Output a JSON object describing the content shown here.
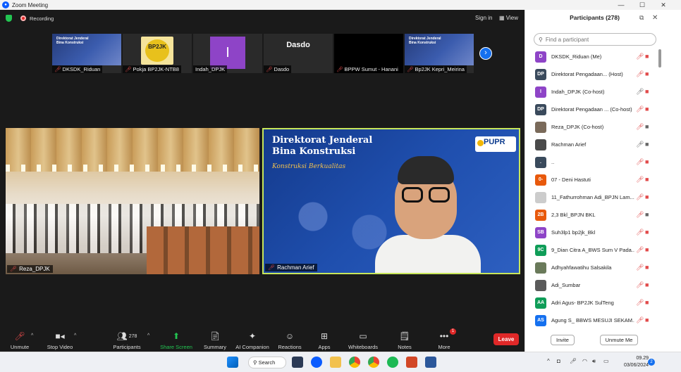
{
  "window": {
    "title": "Zoom Meeting",
    "min": "—",
    "max": "☐",
    "close": "✕"
  },
  "topbar": {
    "recording": "Recording",
    "signin": "Sign in",
    "view": "View"
  },
  "strip": [
    {
      "name": "DKSDK_Riduan",
      "muted": true
    },
    {
      "name": "Pokja BP2JK-NTB8",
      "muted": true,
      "logo_text": "BP2JK"
    },
    {
      "name": "Indah_DPJK",
      "muted": false,
      "initial": "I"
    },
    {
      "name": "Dasdo",
      "muted": true,
      "display": "Dasdo"
    },
    {
      "name": "BPPW Sumut - Hanani",
      "muted": true
    },
    {
      "name": "Bp2JK Kepri_Meirina",
      "muted": true
    }
  ],
  "main_tiles": {
    "left": {
      "name": "Reza_DPJK"
    },
    "right": {
      "name": "Rachman Arief",
      "slide_title_1": "Direktorat Jenderal",
      "slide_title_2": "Bina Konstruksi",
      "slide_subtitle": "Konstruksi Berkualitas",
      "logo": "PUPR"
    }
  },
  "toolbar": {
    "unmute": "Unmute",
    "stop_video": "Stop Video",
    "participants": "Participants",
    "participants_count": "278",
    "share_screen": "Share Screen",
    "summary": "Summary",
    "ai_companion": "AI Companion",
    "reactions": "Reactions",
    "apps": "Apps",
    "whiteboards": "Whiteboards",
    "notes": "Notes",
    "more": "More",
    "more_badge": "1",
    "leave": "Leave"
  },
  "panel": {
    "title": "Participants (278)",
    "search_placeholder": "Find a participant",
    "invite": "Invite",
    "unmute_me": "Unmute Me",
    "participants": [
      {
        "initials": "D",
        "name": "DKSDK_Riduan (Me)",
        "color": "#8e44c7",
        "mic": "muted",
        "cam": "off"
      },
      {
        "initials": "DP",
        "name": "Direktorat Pengadaan... (Host)",
        "color": "#3a4a5c",
        "mic": "muted",
        "cam": "off",
        "rec": true
      },
      {
        "initials": "I",
        "name": "Indah_DPJK (Co-host)",
        "color": "#8e44c7",
        "mic": "on",
        "cam": "off"
      },
      {
        "initials": "DP",
        "name": "Direktorat Pengadaan ... (Co-host)",
        "color": "#3a4a5c",
        "mic": "muted",
        "cam": "off"
      },
      {
        "initials": "",
        "name": "Reza_DPJK (Co-host)",
        "color": "#7a6a5a",
        "mic": "muted",
        "cam": "on"
      },
      {
        "initials": "",
        "name": "Rachman Arief",
        "color": "#4a4a4a",
        "mic": "on",
        "cam": "on"
      },
      {
        "initials": ".",
        "name": "..",
        "color": "#3a4a5c",
        "mic": "muted",
        "cam": "off"
      },
      {
        "initials": "0-",
        "name": "07 - Deni Hastuti",
        "color": "#e8590c",
        "mic": "muted",
        "cam": "off"
      },
      {
        "initials": "",
        "name": "11_Fathurrohman Adi_BPJN Lam...",
        "color": "#cccccc",
        "mic": "muted",
        "cam": "off"
      },
      {
        "initials": "2B",
        "name": "2,3 Bkl_BPJN BKL",
        "color": "#e8590c",
        "mic": "muted",
        "cam": "on"
      },
      {
        "initials": "SB",
        "name": "Suh3lp1 bp2jk_Bkl",
        "color": "#8e44c7",
        "mic": "muted",
        "cam": "off"
      },
      {
        "initials": "9C",
        "name": "9_Dian Citra A_BWS Sum V Pada...",
        "color": "#0f9d58",
        "mic": "muted",
        "cam": "off"
      },
      {
        "initials": "",
        "name": "Adhyahfawatihu Salsakila",
        "color": "#6a7a5a",
        "mic": "muted",
        "cam": "off"
      },
      {
        "initials": "",
        "name": "Adi_Sumbar",
        "color": "#5a5a5a",
        "mic": "muted",
        "cam": "off"
      },
      {
        "initials": "AA",
        "name": "Adri Agus- BP2JK SulTeng",
        "color": "#0f9d58",
        "mic": "muted",
        "cam": "off"
      },
      {
        "initials": "AS",
        "name": "Agung S_ BBWS MESUJI SEKAM...",
        "color": "#1570ef",
        "mic": "muted",
        "cam": "off"
      }
    ]
  },
  "taskbar": {
    "search": "Search",
    "time": "09.29",
    "date": "03/06/2024",
    "notifications": "2"
  },
  "colors": {
    "accent": "#0b5cff",
    "share_green": "#23c552",
    "leave_red": "#e02828",
    "muted_red": "#e14a4a"
  }
}
